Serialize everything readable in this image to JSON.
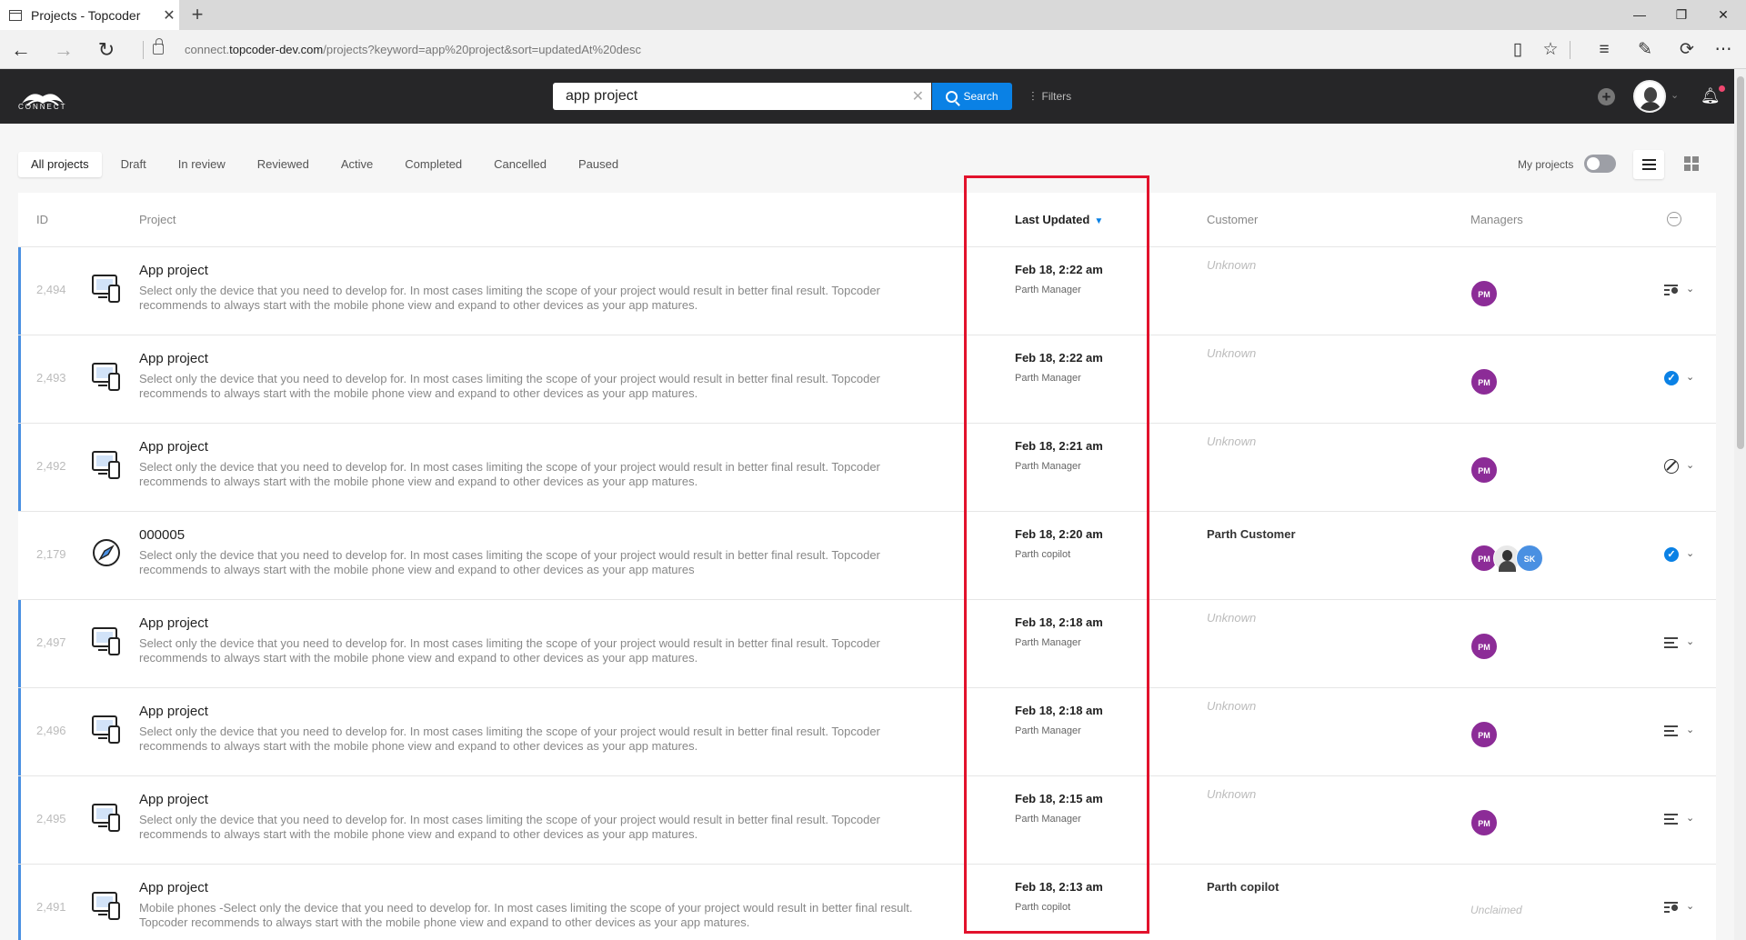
{
  "browser": {
    "tab_title": "Projects - Topcoder",
    "url_prefix": "connect.",
    "url_domain": "topcoder-dev.com",
    "url_path": "/projects?keyword=app%20project&sort=updatedAt%20desc"
  },
  "header": {
    "logo_text": "CONNECT",
    "search_value": "app project",
    "search_button": "Search",
    "filters_label": "Filters"
  },
  "filter_tabs": [
    "All projects",
    "Draft",
    "In review",
    "Reviewed",
    "Active",
    "Completed",
    "Cancelled",
    "Paused"
  ],
  "active_filter": "All projects",
  "my_projects_label": "My projects",
  "my_projects_on": false,
  "columns": {
    "id": "ID",
    "project": "Project",
    "last_updated": "Last Updated",
    "customer": "Customer",
    "managers": "Managers"
  },
  "rows": [
    {
      "id": "2,494",
      "title": "App project",
      "desc": "Select only the device that you need to develop for. In most cases limiting the scope of your project would result in better final result. Topcoder recommends to always start with the mobile phone view and expand to other devices as your app matures.",
      "updated": "Feb 18, 2:22 am",
      "updated_by": "Parth Manager",
      "customer": "Unknown",
      "managers": [
        "PM"
      ],
      "status": "review"
    },
    {
      "id": "2,493",
      "title": "App project",
      "desc": "Select only the device that you need to develop for. In most cases limiting the scope of your project would result in better final result. Topcoder recommends to always start with the mobile phone view and expand to other devices as your app matures.",
      "updated": "Feb 18, 2:22 am",
      "updated_by": "Parth Manager",
      "customer": "Unknown",
      "managers": [
        "PM"
      ],
      "status": "check"
    },
    {
      "id": "2,492",
      "title": "App project",
      "desc": "Select only the device that you need to develop for. In most cases limiting the scope of your project would result in better final result. Topcoder recommends to always start with the mobile phone view and expand to other devices as your app matures.",
      "updated": "Feb 18, 2:21 am",
      "updated_by": "Parth Manager",
      "customer": "Unknown",
      "managers": [
        "PM"
      ],
      "status": "cancel"
    },
    {
      "id": "2,179",
      "title": "000005",
      "desc": "Select only the device that you need to develop for. In most cases limiting the scope of your project would result in better final result. Topcoder recommends to always start with the mobile phone view and expand to other devices as your app matures",
      "updated": "Feb 18, 2:20 am",
      "updated_by": "Parth copilot",
      "customer": "Parth Customer",
      "managers": [
        "PM",
        "",
        "SK"
      ],
      "status": "check"
    },
    {
      "id": "2,497",
      "title": "App project",
      "desc": "Select only the device that you need to develop for. In most cases limiting the scope of your project would result in better final result. Topcoder recommends to always start with the mobile phone view and expand to other devices as your app matures.",
      "updated": "Feb 18, 2:18 am",
      "updated_by": "Parth Manager",
      "customer": "Unknown",
      "managers": [
        "PM"
      ],
      "status": "draft"
    },
    {
      "id": "2,496",
      "title": "App project",
      "desc": "Select only the device that you need to develop for. In most cases limiting the scope of your project would result in better final result. Topcoder recommends to always start with the mobile phone view and expand to other devices as your app matures.",
      "updated": "Feb 18, 2:18 am",
      "updated_by": "Parth Manager",
      "customer": "Unknown",
      "managers": [
        "PM"
      ],
      "status": "draft"
    },
    {
      "id": "2,495",
      "title": "App project",
      "desc": "Select only the device that you need to develop for. In most cases limiting the scope of your project would result in better final result. Topcoder recommends to always start with the mobile phone view and expand to other devices as your app matures.",
      "updated": "Feb 18, 2:15 am",
      "updated_by": "Parth Manager",
      "customer": "Unknown",
      "managers": [
        "PM"
      ],
      "status": "draft"
    },
    {
      "id": "2,491",
      "title": "App project",
      "desc": "Mobile phones -Select only the device that you need to develop for. In most cases limiting the scope of your project would result in better final result. Topcoder recommends to always start with the mobile phone view and expand to other devices as your app matures.",
      "updated": "Feb 18, 2:13 am",
      "updated_by": "Parth copilot",
      "customer": "Parth copilot",
      "managers_text": "Unclaimed",
      "status": "review"
    }
  ],
  "colors": {
    "accent": "#0a81e5",
    "header_bg": "#262628",
    "manager_avatar": "#8c2c97",
    "highlight": "#e2122c"
  }
}
